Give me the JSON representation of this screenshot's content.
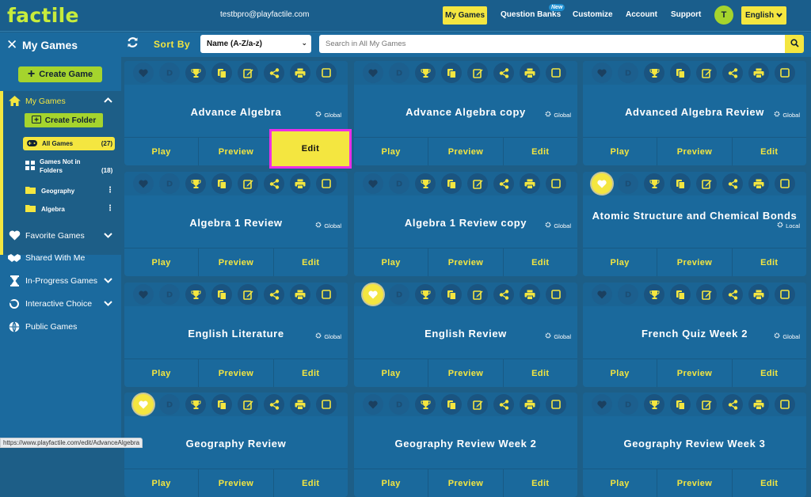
{
  "app": {
    "logo": "factile",
    "email": "testbpro@playfactile.com"
  },
  "nav": {
    "my_games": "My Games",
    "question_banks": "Question Banks",
    "new_badge": "New",
    "customize": "Customize",
    "account": "Account",
    "support": "Support",
    "avatar_letter": "T",
    "language": "English"
  },
  "sidebar": {
    "title": "My Games",
    "create_game": "Create Game",
    "my_games": "My Games",
    "create_folder": "Create Folder",
    "all_games": {
      "label": "All Games",
      "count": "(27)"
    },
    "not_in_folders": {
      "label1": "Games Not in",
      "label2": "Folders",
      "count": "(18)"
    },
    "folders": [
      "Geography",
      "Algebra"
    ],
    "favorite_games": "Favorite Games",
    "shared_with_me": "Shared With Me",
    "in_progress": "In-Progress Games",
    "interactive_choice": "Interactive Choice",
    "public_games": "Public Games"
  },
  "toolbar": {
    "sort_by": "Sort By",
    "sort_value": "Name (A-Z/a-z)",
    "search_placeholder": "Search in All My Games"
  },
  "card_actions": {
    "play": "Play",
    "preview": "Preview",
    "edit": "Edit"
  },
  "cards": [
    {
      "title": "Advance Algebra",
      "visibility": "Global",
      "favorited": false
    },
    {
      "title": "Advance Algebra copy",
      "visibility": "Global",
      "favorited": false
    },
    {
      "title": "Advanced Algebra Review",
      "visibility": "Global",
      "favorited": false
    },
    {
      "title": "Algebra 1 Review",
      "visibility": "Global",
      "favorited": false
    },
    {
      "title": "Algebra 1 Review copy",
      "visibility": "Global",
      "favorited": false
    },
    {
      "title": "Atomic Structure and Chemical Bonds",
      "visibility": "Local",
      "favorited": true
    },
    {
      "title": "English Literature",
      "visibility": "Global",
      "favorited": false
    },
    {
      "title": "English Review",
      "visibility": "Global",
      "favorited": true
    },
    {
      "title": "French Quiz Week 2",
      "visibility": "Global",
      "favorited": false
    },
    {
      "title": "Geography Review",
      "visibility": "",
      "favorited": true
    },
    {
      "title": "Geography Review Week 2",
      "visibility": "",
      "favorited": false
    },
    {
      "title": "Geography Review Week 3",
      "visibility": "",
      "favorited": false
    }
  ],
  "status_url": "https://www.playfactile.com/edit/AdvanceAlgebra",
  "colors": {
    "accent_yellow": "#f4e640",
    "lime": "#a5d42d",
    "bg": "#1d5e87",
    "highlight": "#ea2fe6"
  }
}
